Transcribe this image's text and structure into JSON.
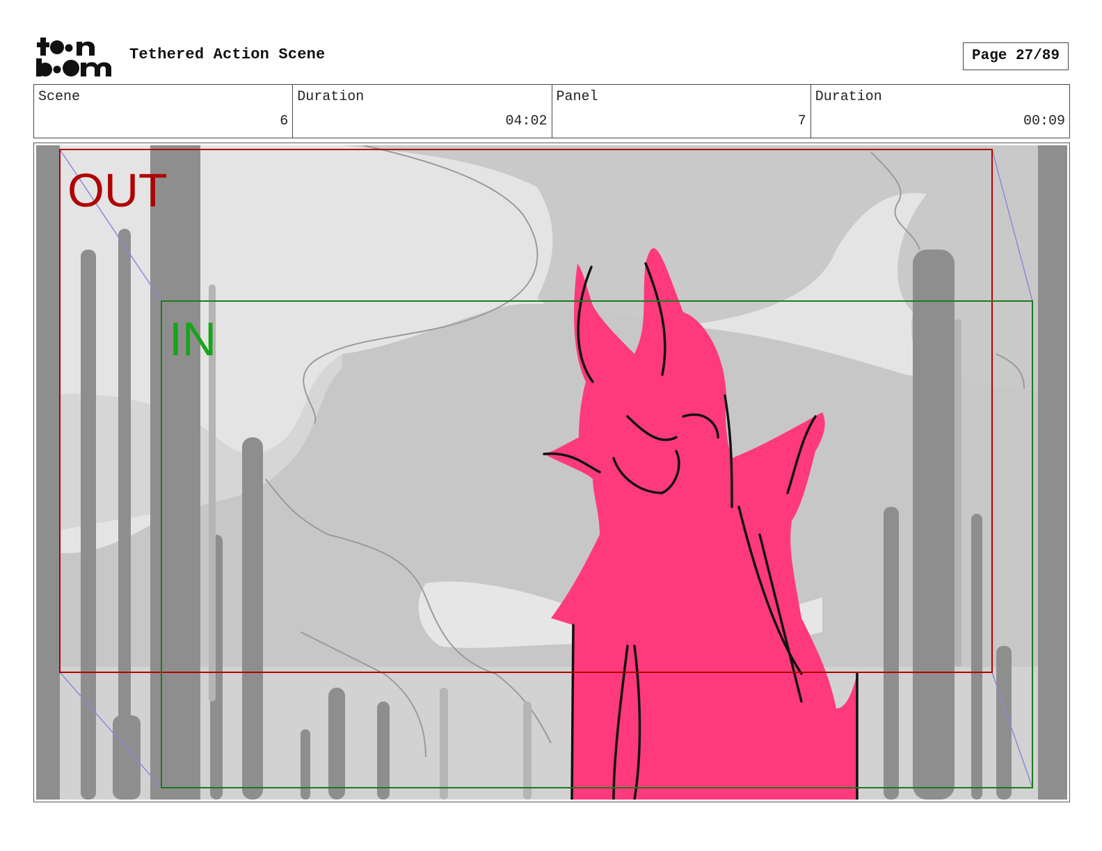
{
  "header": {
    "logo_text": "toon boom",
    "title": "Tethered Action Scene",
    "page_label": "Page 27/89"
  },
  "info": [
    {
      "label": "Scene",
      "value": "6"
    },
    {
      "label": "Duration",
      "value": "04:02"
    },
    {
      "label": "Panel",
      "value": "7"
    },
    {
      "label": "Duration",
      "value": "00:09"
    }
  ],
  "panel": {
    "out_label": "OUT",
    "in_label": "IN",
    "colors": {
      "out_frame": "#b00000",
      "in_frame": "#1c7a1c",
      "in_text": "#18a418",
      "character_fill": "#ff3a7c",
      "camera_path": "#8a8ad8"
    }
  }
}
